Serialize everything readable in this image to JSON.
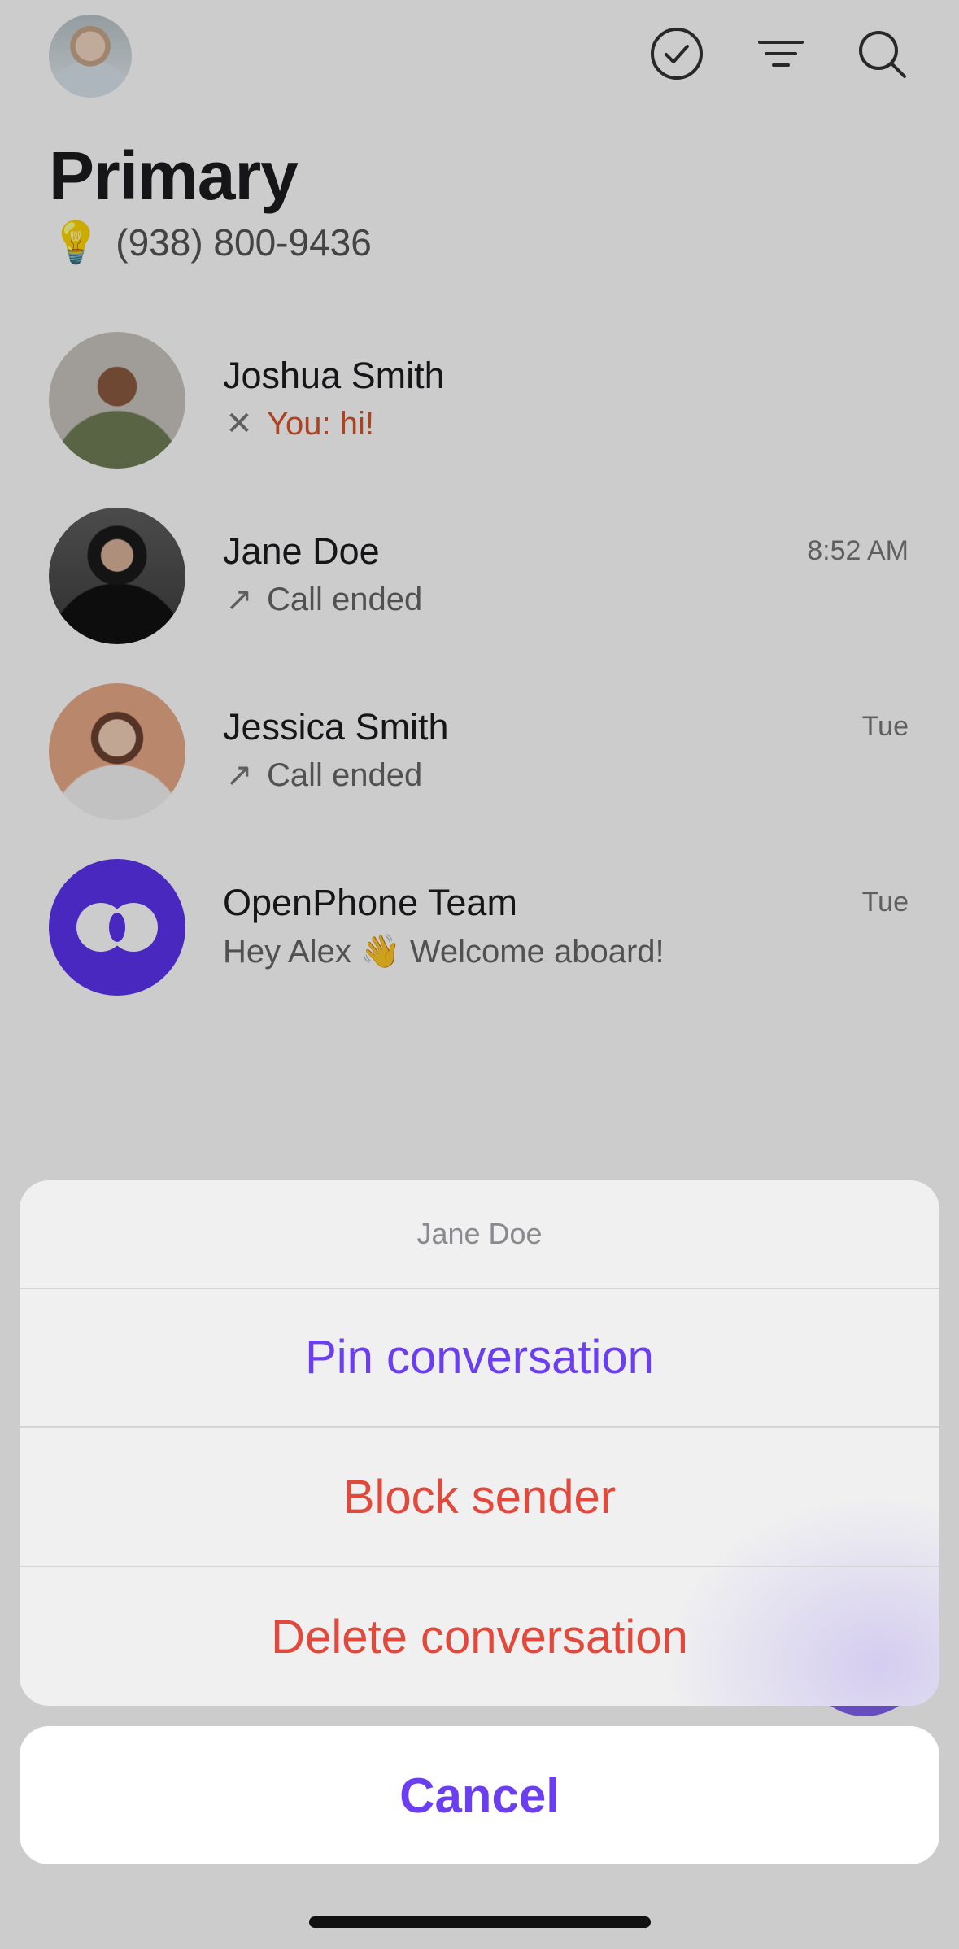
{
  "header": {
    "title": "Primary",
    "bulb_emoji": "💡",
    "phone_number": "(938) 800-9436",
    "icons": [
      "check-circle-icon",
      "filter-icon",
      "search-icon"
    ]
  },
  "conversations": [
    {
      "name": "Joshua Smith",
      "time": "",
      "preview": "You: hi!",
      "preview_icon": "✕",
      "status": "failed"
    },
    {
      "name": "Jane Doe",
      "time": "8:52 AM",
      "preview": "Call ended",
      "preview_icon": "↗"
    },
    {
      "name": "Jessica Smith",
      "time": "Tue",
      "preview": "Call ended",
      "preview_icon": "↗"
    },
    {
      "name": "OpenPhone Team",
      "time": "Tue",
      "preview": "Hey Alex 👋 Welcome aboard!"
    }
  ],
  "action_sheet": {
    "title": "Jane Doe",
    "items": [
      "Pin conversation",
      "Block sender",
      "Delete conversation"
    ],
    "cancel": "Cancel"
  },
  "colors": {
    "accent": "#6b3ff0",
    "destructive": "#e0493c",
    "error_text": "#d9532a",
    "brand": "#5c32f0"
  }
}
